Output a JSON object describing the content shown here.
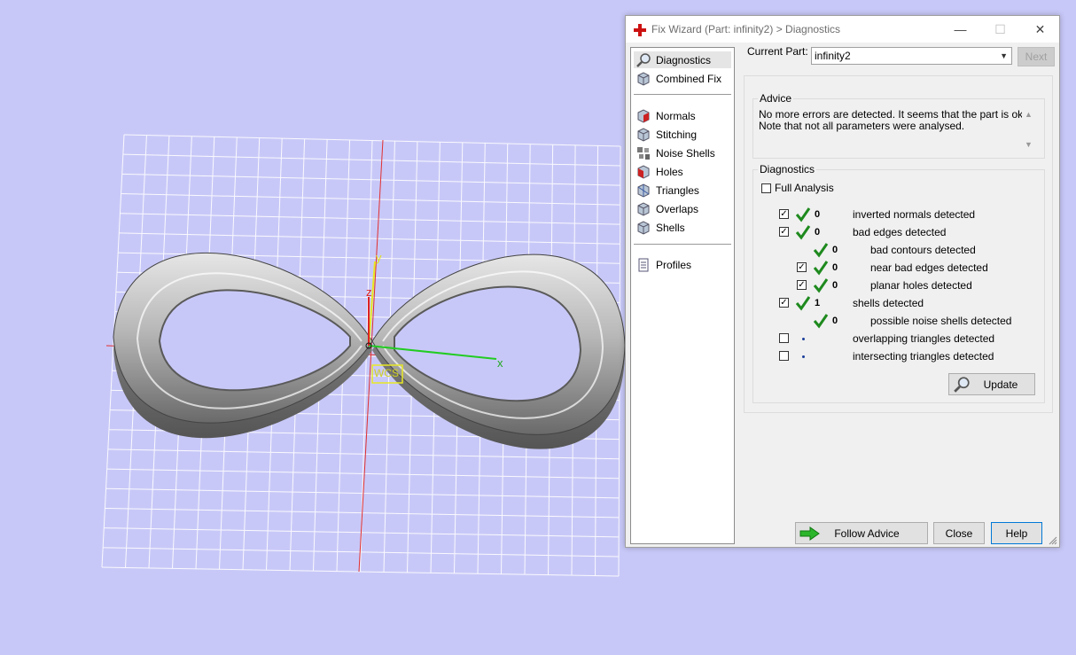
{
  "viewport": {
    "axis_labels": {
      "x": "x",
      "y": "y",
      "z": "z"
    },
    "wcs_label": "WCS"
  },
  "dialog": {
    "title": "Fix Wizard (Part: infinity2) > Diagnostics",
    "window_buttons": {
      "minimize": "—",
      "maximize": "☐",
      "close": "✕"
    },
    "sidebar": {
      "items": [
        {
          "label": "Diagnostics",
          "icon": "magnifier-icon",
          "selected": true
        },
        {
          "label": "Combined Fix",
          "icon": "cube-icon"
        },
        {
          "label": "Normals",
          "icon": "normals-cube-icon"
        },
        {
          "label": "Stitching",
          "icon": "stitching-cube-icon"
        },
        {
          "label": "Noise Shells",
          "icon": "noise-shells-icon"
        },
        {
          "label": "Holes",
          "icon": "holes-cube-icon"
        },
        {
          "label": "Triangles",
          "icon": "triangles-cube-icon"
        },
        {
          "label": "Overlaps",
          "icon": "overlaps-cube-icon"
        },
        {
          "label": "Shells",
          "icon": "shells-cube-icon"
        },
        {
          "label": "Profiles",
          "icon": "document-icon"
        }
      ]
    },
    "current_part_label": "Current Part:",
    "current_part_value": "infinity2",
    "next_button": "Next",
    "advice": {
      "title": "Advice",
      "text_line1": "No more errors are detected. It seems that the part is ok.",
      "text_line2": "Note that not all parameters were analysed."
    },
    "diagnostics": {
      "title": "Diagnostics",
      "full_analysis_label": "Full Analysis",
      "full_analysis_checked": false,
      "rows": [
        {
          "checked": true,
          "status": "ok",
          "count": "0",
          "label": "inverted normals detected"
        },
        {
          "checked": true,
          "status": "ok",
          "count": "0",
          "label": "bad edges detected"
        },
        {
          "checked": null,
          "status": "ok",
          "count": "0",
          "label": "bad contours detected"
        },
        {
          "checked": true,
          "status": "ok",
          "count": "0",
          "label": "near bad edges detected"
        },
        {
          "checked": true,
          "status": "ok",
          "count": "0",
          "label": "planar holes detected"
        },
        {
          "checked": true,
          "status": "ok",
          "count": "1",
          "label": "shells detected"
        },
        {
          "checked": null,
          "status": "ok",
          "count": "0",
          "label": "possible noise shells detected"
        },
        {
          "checked": false,
          "status": "pending",
          "count": "",
          "label": "overlapping triangles detected"
        },
        {
          "checked": false,
          "status": "pending",
          "count": "",
          "label": "intersecting triangles detected"
        }
      ],
      "update_button": "Update"
    },
    "follow_advice_button": "Follow Advice",
    "close_button": "Close",
    "help_button": "Help"
  },
  "colors": {
    "background": "#c8c8f8",
    "grid": "#ffffff",
    "check_green": "#1e8a1e",
    "axis_x": "#22cc22",
    "axis_y": "#e8e822",
    "axis_z": "#dd2222"
  }
}
